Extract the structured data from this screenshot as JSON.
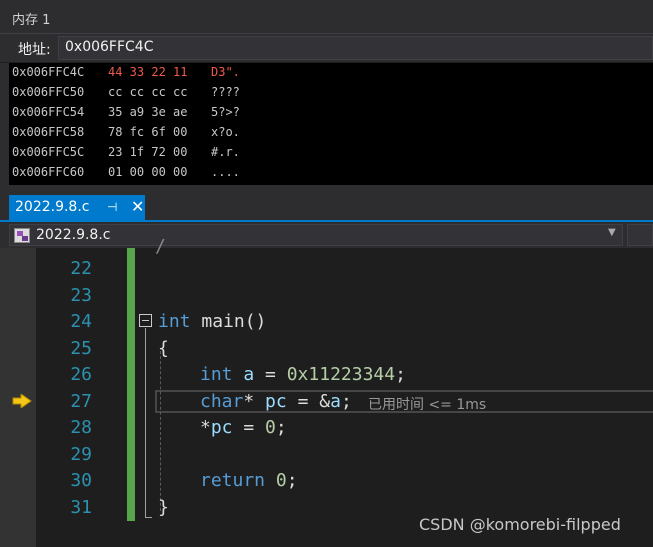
{
  "memory_window": {
    "title": "内存 1",
    "address_label": "地址:",
    "address_value": "0x006FFC4C",
    "rows": [
      {
        "addr": "0x006FFC4C",
        "bytes": "44 33 22 11",
        "ascii": "D3\".",
        "changed": true
      },
      {
        "addr": "0x006FFC50",
        "bytes": "cc cc cc cc",
        "ascii": "????",
        "changed": false
      },
      {
        "addr": "0x006FFC54",
        "bytes": "35 a9 3e ae",
        "ascii": "5?>?",
        "changed": false
      },
      {
        "addr": "0x006FFC58",
        "bytes": "78 fc 6f 00",
        "ascii": "x?o.",
        "changed": false
      },
      {
        "addr": "0x006FFC5C",
        "bytes": "23 1f 72 00",
        "ascii": "#.r.",
        "changed": false
      },
      {
        "addr": "0x006FFC60",
        "bytes": "01 00 00 00",
        "ascii": "....",
        "changed": false
      }
    ]
  },
  "tab": {
    "label": "2022.9.8.c",
    "pin_icon": "pin-icon",
    "close_icon": "close-icon"
  },
  "navbar": {
    "file": "2022.9.8.c"
  },
  "editor": {
    "line_numbers": [
      "22",
      "23",
      "24",
      "25",
      "26",
      "27",
      "28",
      "29",
      "30",
      "31"
    ],
    "lines": {
      "24": {
        "kw": "int",
        "rest": " main()"
      },
      "25": "{",
      "26": {
        "kw": "int",
        "var": " a",
        "rest": " = ",
        "num": "0x11223344",
        "end": ";"
      },
      "27": {
        "kw": "char",
        "rest1": "* ",
        "var": "pc",
        "rest2": " = &",
        "var2": "a",
        "end": ";"
      },
      "28": {
        "rest": "*",
        "var": "pc",
        "rest2": " = ",
        "num": "0",
        "end": ";"
      },
      "30": {
        "kw": "return",
        "rest": " ",
        "num": "0",
        "end": ";"
      },
      "31": "}"
    },
    "elapsed": "已用时间 <= 1ms",
    "current_line": "27"
  },
  "watermark": "CSDN @komorebi-filpped",
  "colors": {
    "accent": "#007acc",
    "changed_bytes": "#f05a4a",
    "change_bar": "#57a64a",
    "keyword": "#569cd6"
  }
}
